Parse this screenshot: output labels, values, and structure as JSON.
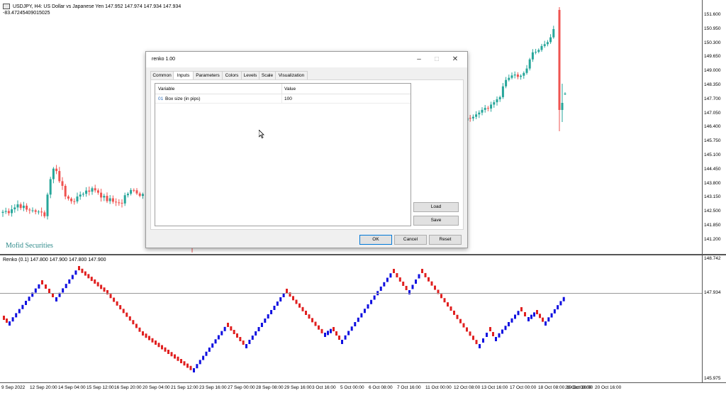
{
  "chart": {
    "header_line1": "USDJPY, H4:  US Dollar vs Japanese Yen  147.952 147.974 147.934 147.934",
    "header_line2": "-83.47245409015025",
    "watermark": "Mofid Securities",
    "price_labels": [
      "151.600",
      "150.950",
      "150.300",
      "149.650",
      "149.000",
      "148.350",
      "147.700",
      "147.050",
      "146.400",
      "145.750",
      "145.100",
      "144.450",
      "143.800",
      "143.150",
      "142.500",
      "141.850",
      "141.200"
    ],
    "indicator_header": "Renko (0.1) 147.800 147.900 147.800 147.900",
    "indicator_labels": [
      "148.742",
      "147.934",
      "145.975"
    ],
    "time_labels": [
      "9 Sep 2022",
      "12 Sep 20:00",
      "14 Sep 04:00",
      "15 Sep 12:00",
      "16 Sep 20:00",
      "20 Sep 04:00",
      "21 Sep 12:00",
      "23 Sep 16:00",
      "27 Sep 00:00",
      "28 Sep 08:00",
      "29 Sep 16:00",
      "3 Oct 16:00",
      "5 Oct 00:00",
      "6 Oct 08:00",
      "7 Oct 16:00",
      "11 Oct 00:00",
      "12 Oct 08:00",
      "13 Oct 16:00",
      "17 Oct 00:00",
      "18 Oct 08:00",
      "19 Oct 16:00",
      "20 Oct 16:00",
      "26 Oct 08:00"
    ],
    "colors": {
      "bull": "#26a69a",
      "bear": "#ef5350",
      "renko_up": "#1010e0",
      "renko_down": "#e02020"
    }
  },
  "dialog": {
    "title": "renko 1.00",
    "tabs": [
      "Common",
      "Inputs",
      "Parameters",
      "Colors",
      "Levels",
      "Scale",
      "Visualization"
    ],
    "active_tab": "Inputs",
    "columns": [
      "Variable",
      "Value"
    ],
    "rows": [
      {
        "index": "01",
        "variable": "Box size (in pips)",
        "value": "100"
      }
    ],
    "side_buttons": [
      "Load",
      "Save"
    ],
    "bottom_buttons": [
      "OK",
      "Cancel",
      "Reset"
    ]
  }
}
